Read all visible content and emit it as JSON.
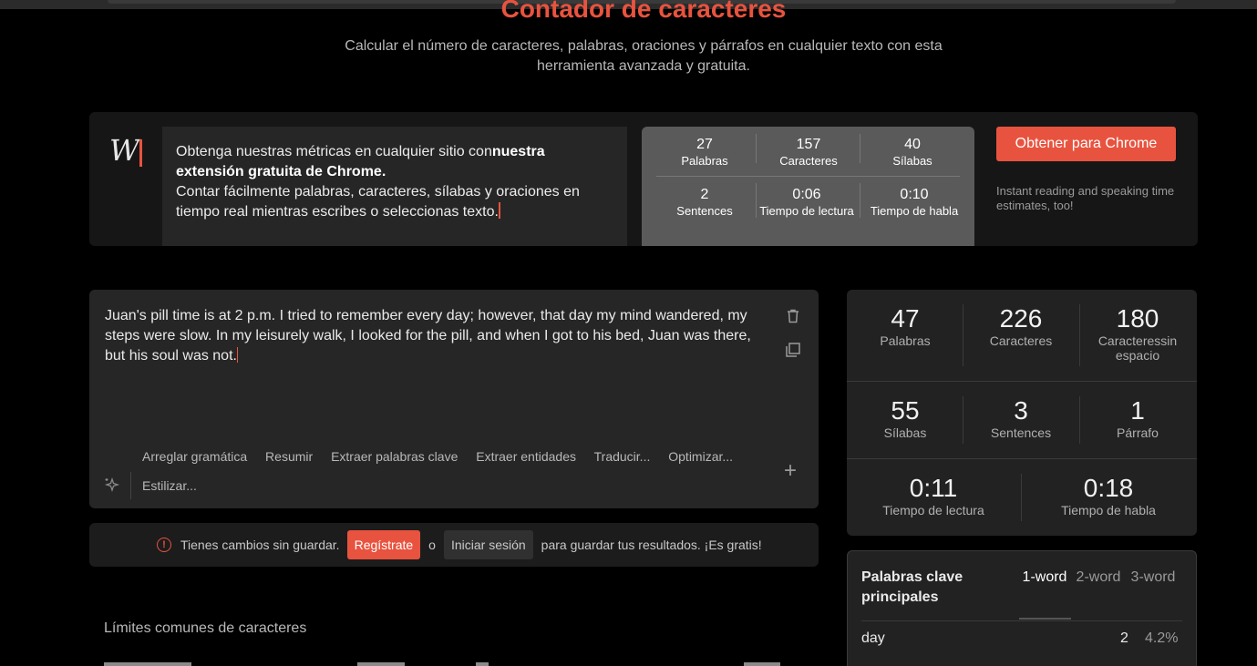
{
  "header": {
    "title": "Contador de caracteres",
    "subtitle": "Calcular el número de caracteres, palabras, oraciones y párrafos en cualquier texto con esta herramienta avanzada y gratuita."
  },
  "promo": {
    "logo": "W",
    "text_lead": "Obtenga nuestras métricas en cualquier sitio con",
    "text_bold": "nuestra extensión gratuita de Chrome.",
    "text_body": "Contar fácilmente palabras, caracteres, sílabas y oraciones en tiempo real mientras escribes o seleccionas texto.",
    "stats": [
      {
        "value": "27",
        "label": "Palabras"
      },
      {
        "value": "157",
        "label": "Caracteres"
      },
      {
        "value": "40",
        "label": "Sílabas"
      },
      {
        "value": "2",
        "label": "Sentences"
      },
      {
        "value": "0:06",
        "label": "Tiempo de lectura"
      },
      {
        "value": "0:10",
        "label": "Tiempo de habla"
      }
    ],
    "button": "Obtener para Chrome",
    "note": "Instant reading and speaking time estimates, too!"
  },
  "editor": {
    "text": "Juan's pill time is at 2 p.m. I tried to remember every day; however, that day my mind wandered, my steps were slow. In my leisurely walk, I looked for the pill, and when I got to his bed, Juan was there, but his soul was not.",
    "tools": [
      "Arreglar gramática",
      "Resumir",
      "Extraer palabras clave",
      "Extraer entidades",
      "Traducir...",
      "Optimizar..."
    ],
    "style": "Estilizar..."
  },
  "unsaved": {
    "message": "Tienes cambios sin guardar.",
    "register": "Regístrate",
    "or": "o",
    "login": "Iniciar sesión",
    "suffix": "para guardar tus resultados. ¡Es gratis!"
  },
  "limits": {
    "title": "Límites comunes de caracteres"
  },
  "stats": {
    "row1": [
      {
        "value": "47",
        "label": "Palabras"
      },
      {
        "value": "226",
        "label": "Caracteres"
      },
      {
        "value": "180",
        "label": "Caracteressin espacio"
      }
    ],
    "row2": [
      {
        "value": "55",
        "label": "Sílabas"
      },
      {
        "value": "3",
        "label": "Sentences"
      },
      {
        "value": "1",
        "label": "Párrafo"
      }
    ],
    "row3": [
      {
        "value": "0:11",
        "label": "Tiempo de lectura"
      },
      {
        "value": "0:18",
        "label": "Tiempo de habla"
      }
    ]
  },
  "keywords": {
    "title": "Palabras clave principales",
    "tabs": [
      "1-word",
      "2-word",
      "3-word"
    ],
    "active_tab": "1-word",
    "rows": [
      {
        "word": "day",
        "count": "2",
        "pct": "4.2%"
      }
    ]
  },
  "colors": {
    "accent": "#e8533f",
    "background": "#000000",
    "panel": "#262626"
  }
}
